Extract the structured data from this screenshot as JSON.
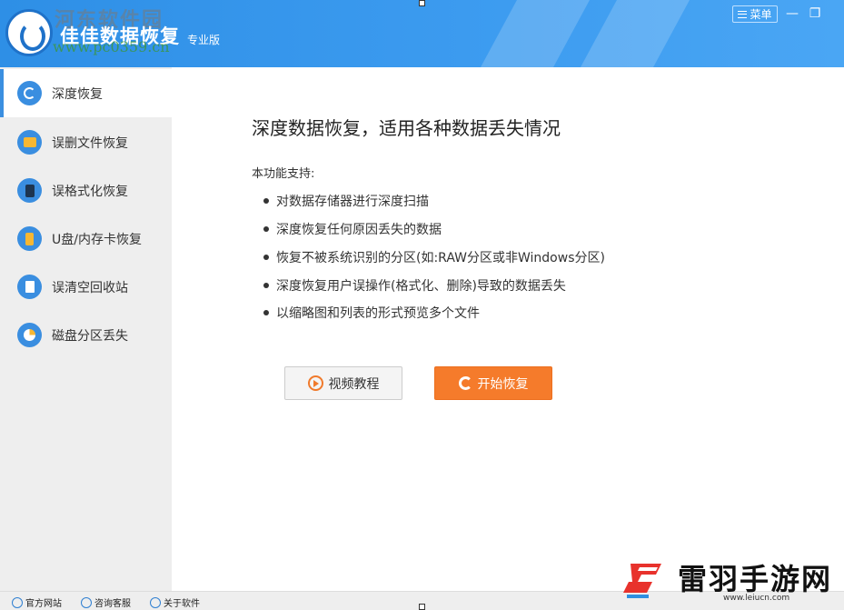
{
  "window": {
    "watermark": "河东软件园",
    "watermark_url": "www.pc0359.cn",
    "title": "佳佳数据恢复",
    "edition": "专业版",
    "menu_label": "菜单",
    "minimize_glyph": "—",
    "restore_glyph": "❐"
  },
  "sidebar": {
    "items": [
      {
        "label": "深度恢复",
        "icon": "refresh-icon",
        "active": true
      },
      {
        "label": "误删文件恢复",
        "icon": "folder-icon",
        "active": false
      },
      {
        "label": "误格式化恢复",
        "icon": "disk-icon",
        "active": false
      },
      {
        "label": "U盘/内存卡恢复",
        "icon": "usb-drive-icon",
        "active": false
      },
      {
        "label": "误清空回收站",
        "icon": "recycle-bin-icon",
        "active": false
      },
      {
        "label": "磁盘分区丢失",
        "icon": "pie-partition-icon",
        "active": false
      }
    ]
  },
  "main": {
    "headline": "深度数据恢复，适用各种数据丢失情况",
    "support_label": "本功能支持:",
    "features": [
      "对数据存储器进行深度扫描",
      "深度恢复任何原因丢失的数据",
      "恢复不被系统识别的分区(如:RAW分区或非Windows分区)",
      "深度恢复用户误操作(格式化、删除)导致的数据丢失",
      "以缩略图和列表的形式预览多个文件"
    ],
    "video_button": "视频教程",
    "start_button": "开始恢复"
  },
  "footer": {
    "links": [
      "官方网站",
      "咨询客服",
      "关于软件"
    ]
  },
  "brand": {
    "name": "雷羽手游网",
    "url": "www.leiucn.com"
  },
  "colors": {
    "titlebar": "#3d9cf0",
    "accent": "#3a8ee0",
    "start_button": "#f57b2b",
    "sidebar_bg": "#eeeeee"
  }
}
